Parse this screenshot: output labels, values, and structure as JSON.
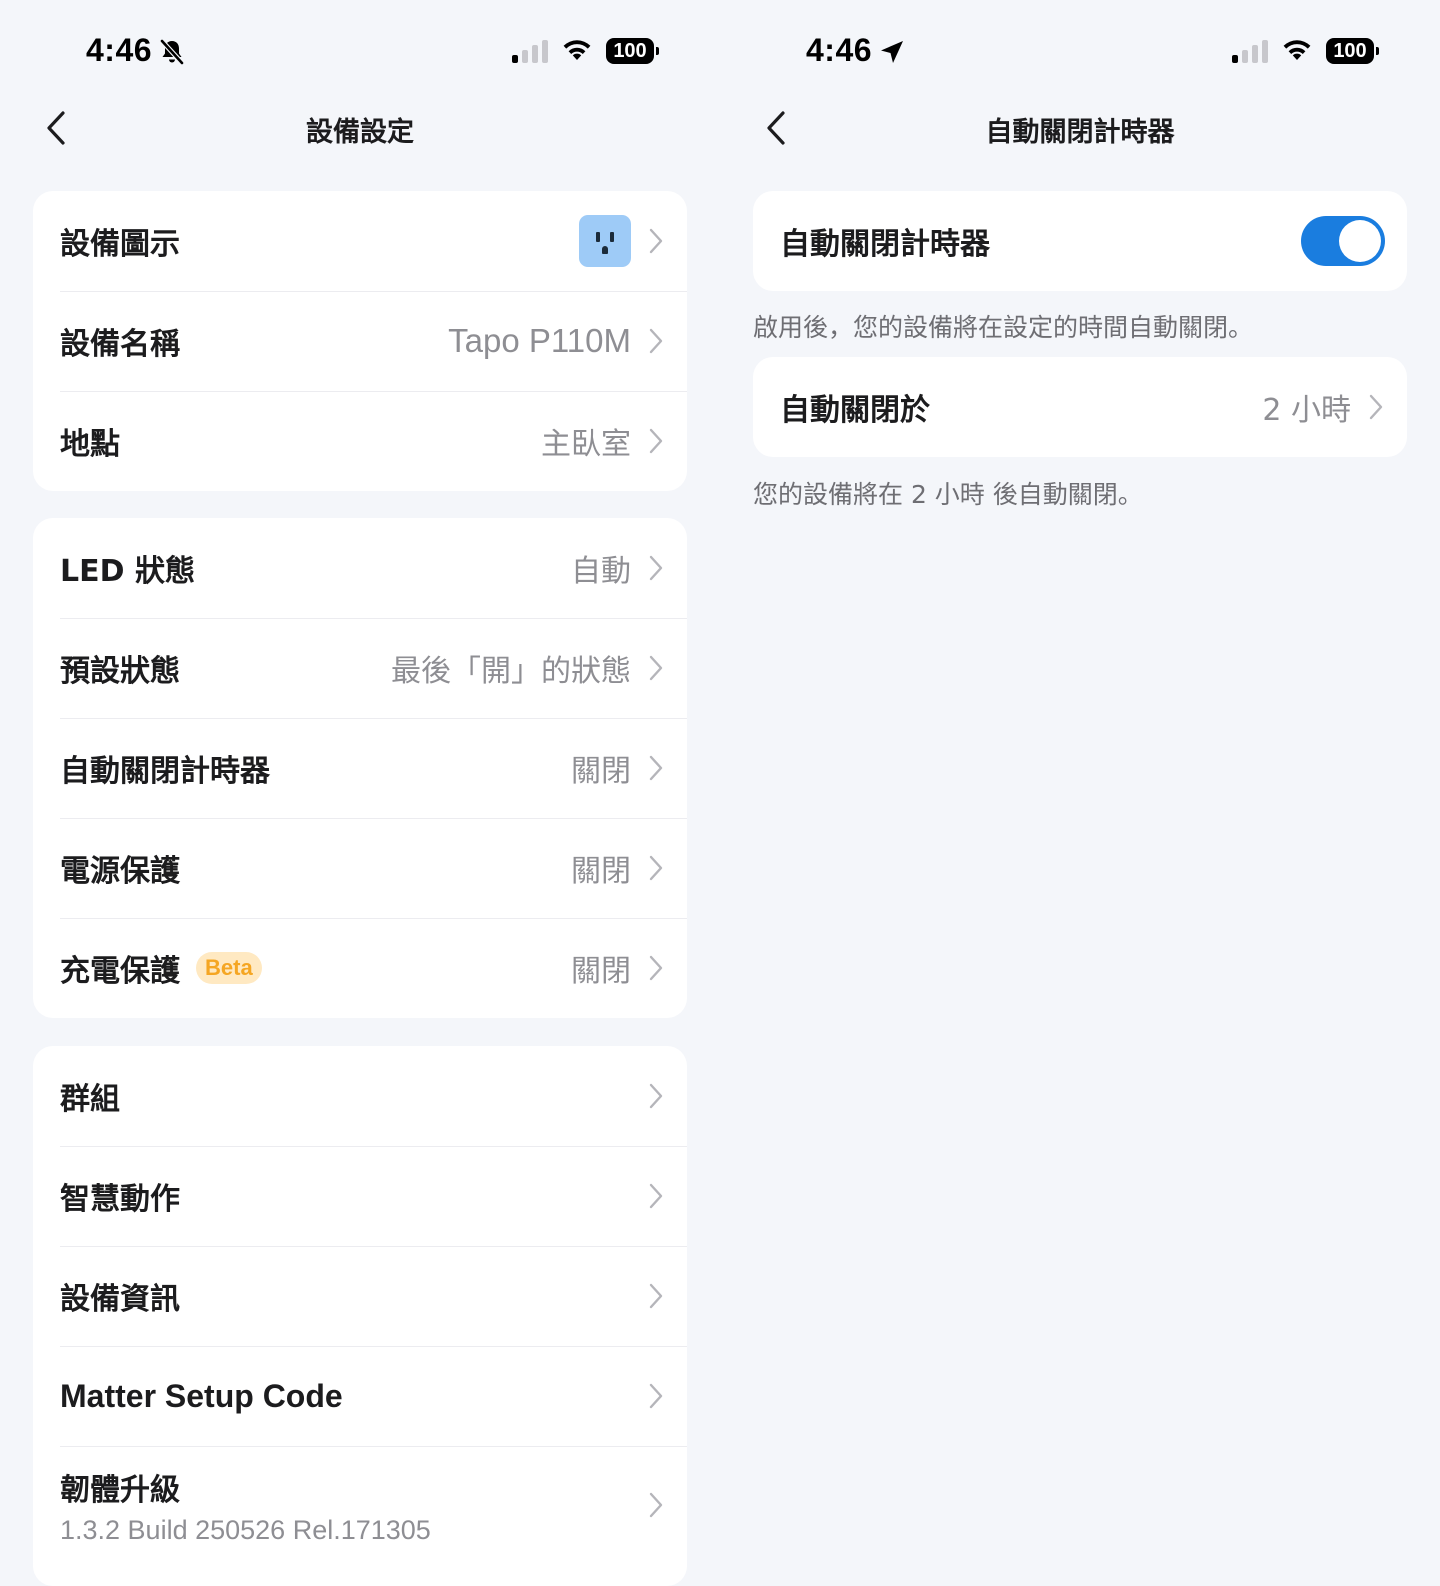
{
  "left": {
    "status": {
      "time": "4:46",
      "battery": "100",
      "indicator_icon": "bell-slash-icon"
    },
    "nav": {
      "title": "設備設定",
      "back_icon": "chevron-left-icon"
    },
    "section1": [
      {
        "label": "設備圖示",
        "value": ""
      },
      {
        "label": "設備名稱",
        "value": "Tapo P110M"
      },
      {
        "label": "地點",
        "value": "主臥室"
      }
    ],
    "section2": [
      {
        "label": "LED 狀態",
        "value": "自動"
      },
      {
        "label": "預設狀態",
        "value": "最後「開」的狀態"
      },
      {
        "label": "自動關閉計時器",
        "value": "關閉"
      },
      {
        "label": "電源保護",
        "value": "關閉"
      },
      {
        "label": "充電保護",
        "badge": "Beta",
        "value": "關閉"
      }
    ],
    "section3": [
      {
        "label": "群組"
      },
      {
        "label": "智慧動作"
      },
      {
        "label": "設備資訊"
      },
      {
        "label": "Matter Setup Code"
      },
      {
        "label": "韌體升級",
        "sub": "1.3.2 Build 250526 Rel.171305"
      }
    ]
  },
  "right": {
    "status": {
      "time": "4:46",
      "battery": "100",
      "indicator_icon": "location-arrow-icon"
    },
    "nav": {
      "title": "自動關閉計時器",
      "back_icon": "chevron-left-icon"
    },
    "toggle_row": {
      "label": "自動關閉計時器",
      "enabled": true
    },
    "toggle_caption": "啟用後，您的設備將在設定的時間自動關閉。",
    "off_after_row": {
      "label": "自動關閉於",
      "value": "2 小時"
    },
    "off_after_caption": "您的設備將在 2 小時 後自動關閉。"
  },
  "colors": {
    "background": "#f4f6fa",
    "card": "#ffffff",
    "accent": "#1a7ddf",
    "secondary_text": "#8e8e93",
    "beta_bg": "#ffe9c2",
    "beta_text": "#f5a623",
    "device_icon_bg": "#9ecbf7"
  }
}
